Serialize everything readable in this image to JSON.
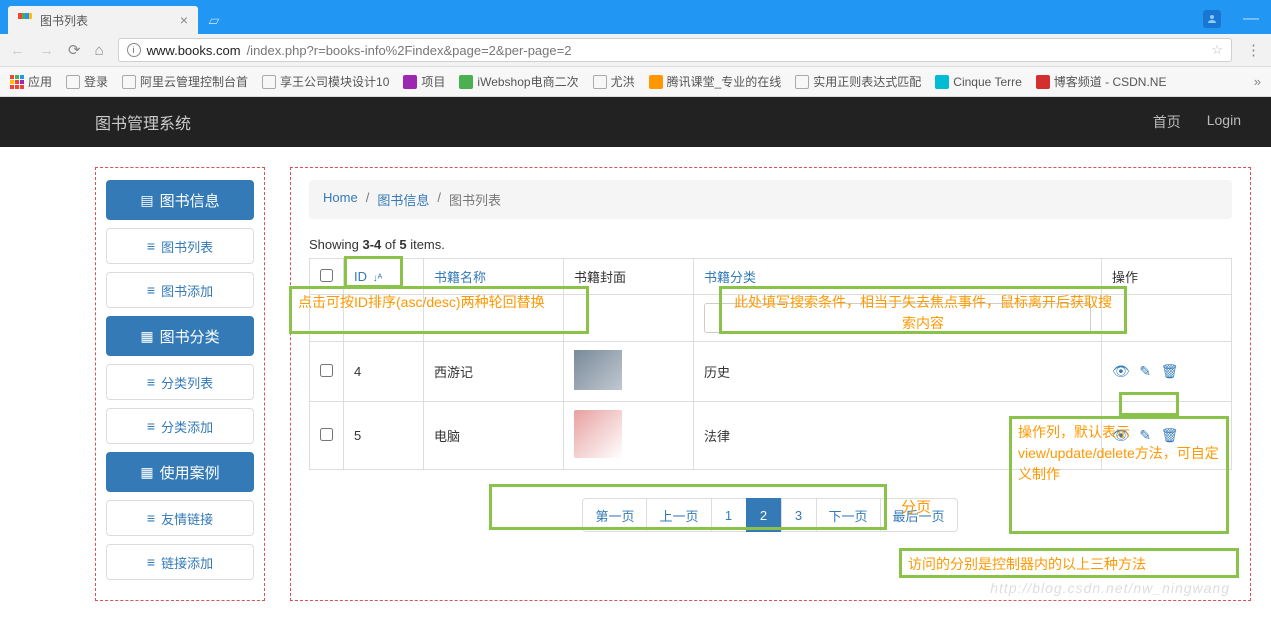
{
  "browser": {
    "tab_title": "图书列表",
    "url_host": "www.books.com",
    "url_path": "/index.php?r=books-info%2Findex&page=2&per-page=2",
    "apps_label": "应用",
    "bookmarks": [
      "登录",
      "阿里云管理控制台首",
      "享王公司模块设计10",
      "项目",
      "iWebshop电商二次",
      "尤洪",
      "腾讯课堂_专业的在线",
      "实用正则表达式匹配",
      "Cinque Terre",
      "博客频道 - CSDN.NE"
    ]
  },
  "nav": {
    "brand": "图书管理系统",
    "home": "首页",
    "login": "Login"
  },
  "sidebar": {
    "groups": [
      {
        "header": "图书信息",
        "items": [
          "图书列表",
          "图书添加"
        ]
      },
      {
        "header": "图书分类",
        "items": [
          "分类列表",
          "分类添加"
        ]
      },
      {
        "header": "使用案例",
        "items": [
          "友情链接",
          "链接添加"
        ]
      }
    ]
  },
  "breadcrumb": {
    "home": "Home",
    "group": "图书信息",
    "page": "图书列表"
  },
  "summary": {
    "prefix": "Showing ",
    "range": "3-4",
    "mid": " of ",
    "total": "5",
    "suffix": " items."
  },
  "table": {
    "headers": {
      "id": "ID",
      "name": "书籍名称",
      "cover": "书籍封面",
      "cat": "书籍分类",
      "act": "操作"
    },
    "rows": [
      {
        "id": "4",
        "name": "西游记",
        "cat": "历史"
      },
      {
        "id": "5",
        "name": "电脑",
        "cat": "法律"
      }
    ]
  },
  "pager": {
    "first": "第一页",
    "prev": "上一页",
    "p1": "1",
    "p2": "2",
    "p3": "3",
    "next": "下一页",
    "last": "最后一页",
    "label": "分页"
  },
  "annotations": {
    "sort": "点击可按ID排序(asc/desc)两种轮回替换",
    "filter": "此处填写搜索条件，相当于失去焦点事件，鼠标离开后获取搜索内容",
    "actions": "操作列，默认表示view/update/delete方法，可自定义制作",
    "route": "访问的分别是控制器内的以上三种方法"
  },
  "watermark": "http://blog.csdn.net/nw_ningwang"
}
